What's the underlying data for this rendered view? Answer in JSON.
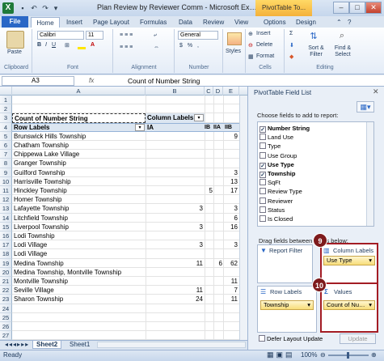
{
  "window": {
    "title": "Plan Review by Reviewer Comm  -  Microsoft Excel",
    "context_tab": "PivotTable To...",
    "buttons": {
      "minimize": "–",
      "restore": "□",
      "close": "✕"
    }
  },
  "ribbon_tabs": [
    "File",
    "Home",
    "Insert",
    "Page Layout",
    "Formulas",
    "Data",
    "Review",
    "View",
    "Options",
    "Design"
  ],
  "ribbon": {
    "paste": "Paste",
    "font_name": "Calibri",
    "font_size": "11",
    "number_format": "General",
    "styles": "Styles",
    "insert": "Insert",
    "delete": "Delete",
    "format": "Format",
    "sort_filter": "Sort & Filter",
    "find_select": "Find & Select",
    "groups": [
      "Clipboard",
      "Font",
      "Alignment",
      "Number",
      "Cells",
      "Editing"
    ]
  },
  "formula_bar": {
    "name_box": "A3",
    "fx": "fx",
    "value": "Count of Number String"
  },
  "sheet": {
    "columns": [
      "A",
      "B",
      "C",
      "D",
      "E"
    ],
    "count_title": "Count of Number String",
    "column_labels": "Column Labels",
    "row_labels": "Row Labels",
    "col_headers": [
      "IA",
      "IB",
      "IIA",
      "IIB"
    ],
    "rows": [
      {
        "label": "Brunswick Hills Township",
        "vals": [
          "",
          "",
          "",
          "9"
        ]
      },
      {
        "label": "Chatham Township",
        "vals": [
          "",
          "",
          "",
          ""
        ]
      },
      {
        "label": "Chippewa Lake Village",
        "vals": [
          "",
          "",
          "",
          ""
        ]
      },
      {
        "label": "Granger Township",
        "vals": [
          "",
          "",
          "",
          ""
        ]
      },
      {
        "label": "Guilford Township",
        "vals": [
          "",
          "",
          "",
          "3"
        ]
      },
      {
        "label": "Harrisville Township",
        "vals": [
          "",
          "",
          "",
          "13"
        ]
      },
      {
        "label": "Hinckley Township",
        "vals": [
          "",
          "5",
          "",
          "17"
        ]
      },
      {
        "label": "Homer Township",
        "vals": [
          "",
          "",
          "",
          ""
        ]
      },
      {
        "label": "Lafayette Township",
        "vals": [
          "3",
          "",
          "",
          "3"
        ]
      },
      {
        "label": "Litchfield Township",
        "vals": [
          "",
          "",
          "",
          "6"
        ]
      },
      {
        "label": "Liverpool Township",
        "vals": [
          "3",
          "",
          "",
          "16"
        ]
      },
      {
        "label": "Lodi Township",
        "vals": [
          "",
          "",
          "",
          ""
        ]
      },
      {
        "label": "Lodi Village",
        "vals": [
          "3",
          "",
          "",
          "3"
        ]
      },
      {
        "label": "Lodi Village",
        "vals": [
          "",
          "",
          "",
          ""
        ]
      },
      {
        "label": "Medina Township",
        "vals": [
          "11",
          "",
          "6",
          "62"
        ]
      },
      {
        "label": "Medina Township, Montville Township",
        "vals": [
          "",
          "",
          "",
          ""
        ]
      },
      {
        "label": "Montville Township",
        "vals": [
          "",
          "",
          "",
          "11"
        ]
      },
      {
        "label": "Seville Village",
        "vals": [
          "11",
          "",
          "",
          "7"
        ]
      },
      {
        "label": "Sharon Township",
        "vals": [
          "24",
          "",
          "",
          "11"
        ]
      }
    ]
  },
  "sheet_tabs": [
    "Sheet2",
    "Sheet1"
  ],
  "pivot_panel": {
    "title": "PivotTable Field List",
    "choose_label": "Choose fields to add to report:",
    "fields": [
      {
        "name": "Number String",
        "checked": true
      },
      {
        "name": "Land Use",
        "checked": false
      },
      {
        "name": "Type",
        "checked": false
      },
      {
        "name": "Use Group",
        "checked": false
      },
      {
        "name": "Use Type",
        "checked": true
      },
      {
        "name": "Township",
        "checked": true
      },
      {
        "name": "SqFt",
        "checked": false
      },
      {
        "name": "Review Type",
        "checked": false
      },
      {
        "name": "Reviewer",
        "checked": false
      },
      {
        "name": "Status",
        "checked": false
      },
      {
        "name": "Is Closed",
        "checked": false
      }
    ],
    "drag_label": "Drag fields between areas below:",
    "report_filter": "Report Filter",
    "column_labels": "Column Labels",
    "column_item": "Use Type",
    "row_labels": "Row Labels",
    "row_item": "Township",
    "values": "Values",
    "values_item": "Count of Num...",
    "defer": "Defer Layout Update",
    "update": "Update",
    "badge_columns": "9",
    "badge_values": "10"
  },
  "status": {
    "ready": "Ready",
    "zoom": "100%"
  }
}
